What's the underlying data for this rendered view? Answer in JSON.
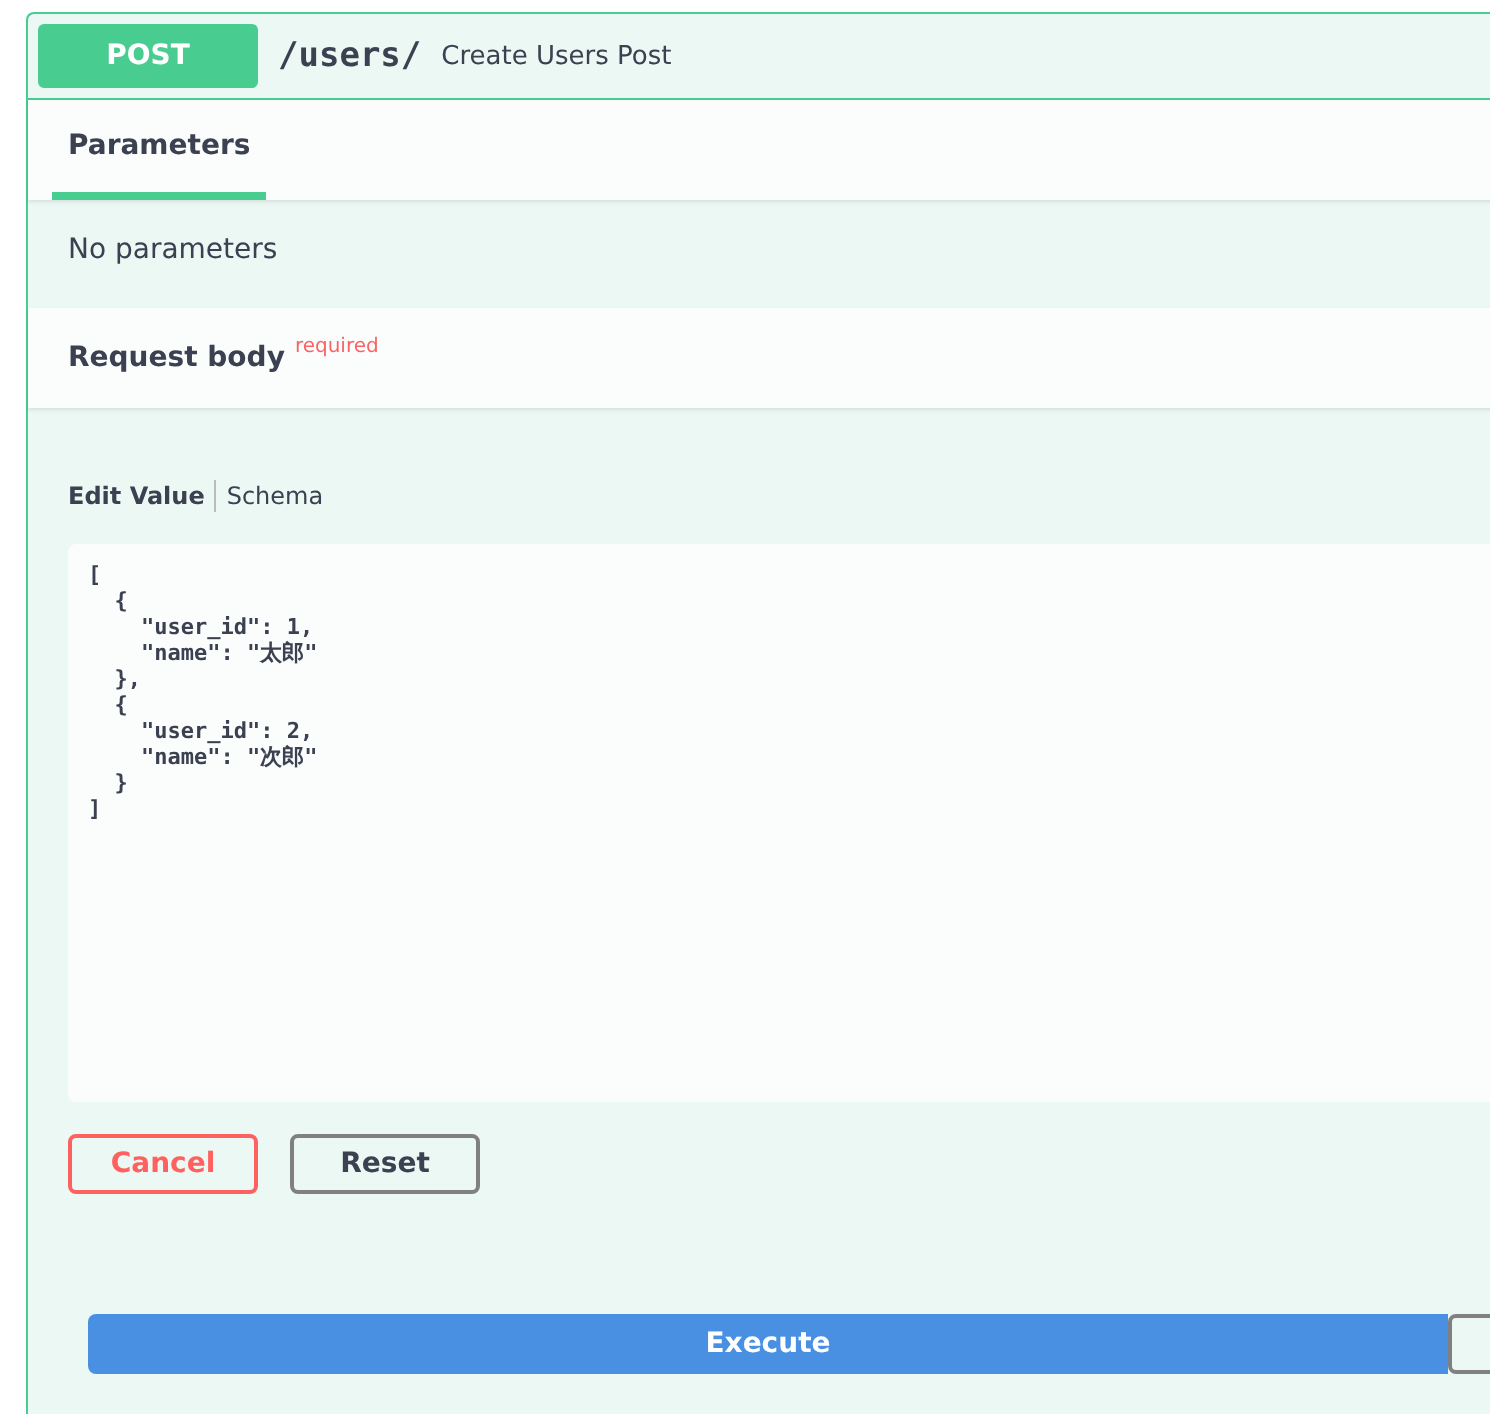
{
  "operation": {
    "method": "POST",
    "path": "/users/",
    "summary": "Create Users Post"
  },
  "tabs": [
    {
      "label": "Parameters",
      "selected": true
    }
  ],
  "parameters_message": "No parameters",
  "request_body": {
    "title": "Request body",
    "required_label": "required"
  },
  "editor_tabs": [
    {
      "label": "Edit Value",
      "selected": true
    },
    {
      "label": "Schema",
      "selected": false
    }
  ],
  "body_value": "[\n  {\n    \"user_id\": 1,\n    \"name\": \"太郎\"\n  },\n  {\n    \"user_id\": 2,\n    \"name\": \"次郎\"\n  }\n]",
  "buttons": [
    {
      "label": "Cancel",
      "kind": "cancel"
    },
    {
      "label": "Reset",
      "kind": "reset"
    }
  ],
  "execute_label": "Execute"
}
